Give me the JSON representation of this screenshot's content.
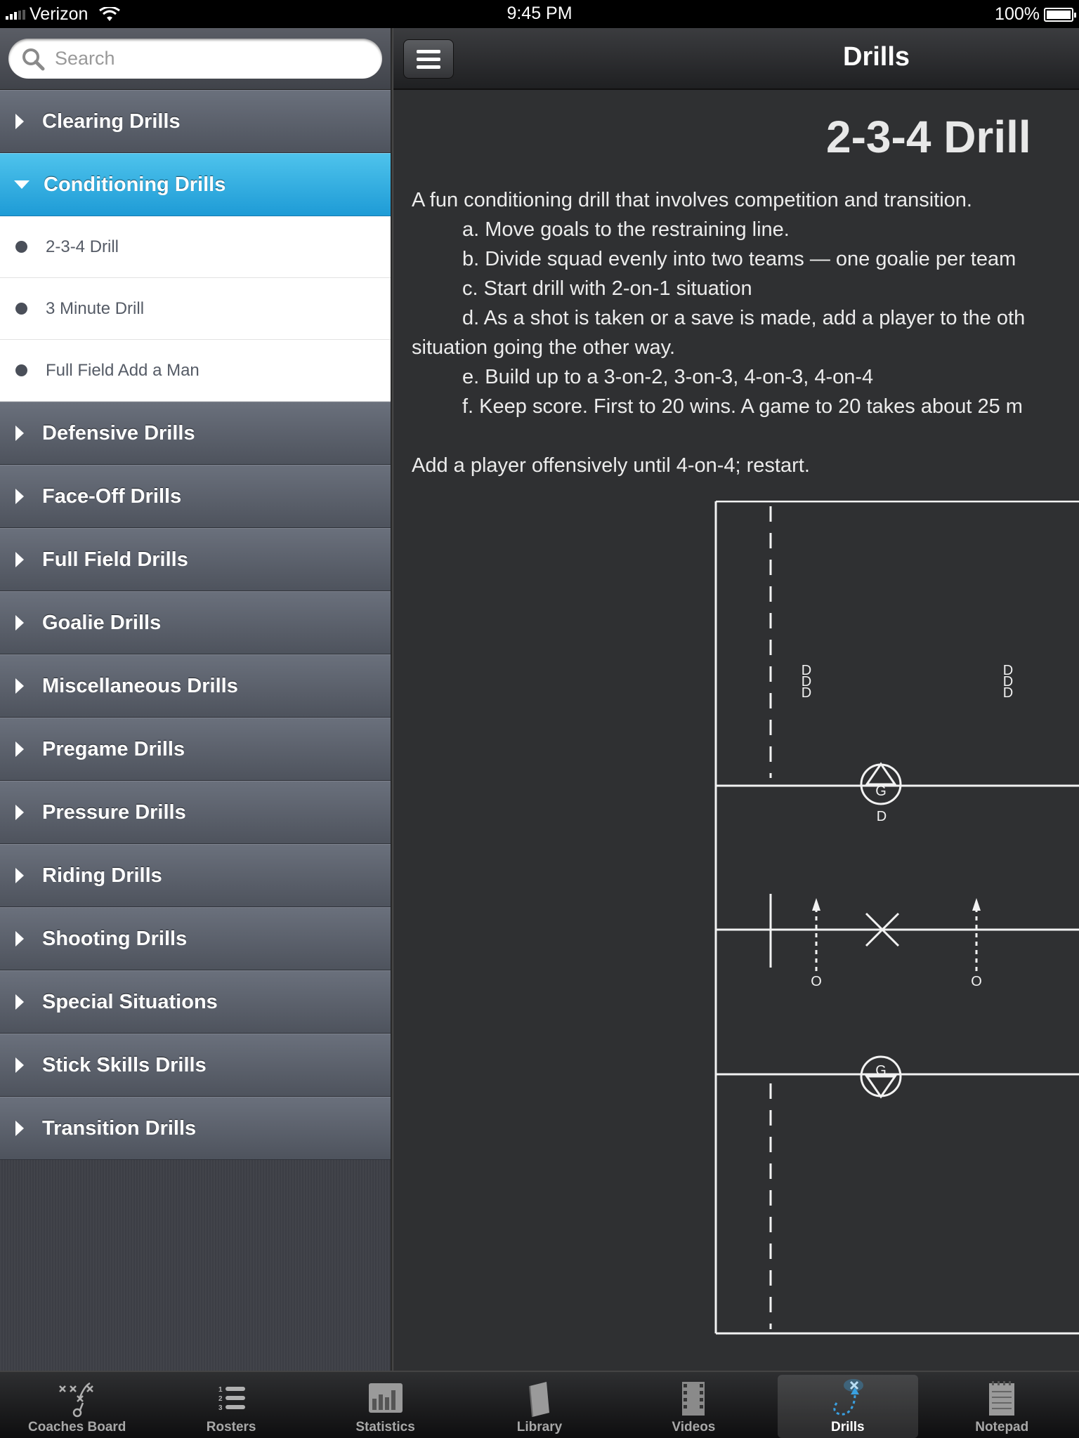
{
  "status_bar": {
    "carrier": "Verizon",
    "time": "9:45 PM",
    "battery": "100%",
    "battery_level": 1.0
  },
  "search": {
    "placeholder": "Search"
  },
  "sidebar": {
    "categories_top": [
      {
        "label": "Clearing Drills"
      },
      {
        "label": "Conditioning Drills",
        "expanded": true
      }
    ],
    "sub_items": [
      {
        "label": "2-3-4 Drill"
      },
      {
        "label": "3 Minute Drill"
      },
      {
        "label": "Full Field Add a Man"
      }
    ],
    "categories_bottom": [
      {
        "label": "Defensive Drills"
      },
      {
        "label": "Face-Off Drills"
      },
      {
        "label": "Full Field Drills"
      },
      {
        "label": "Goalie Drills"
      },
      {
        "label": "Miscellaneous Drills"
      },
      {
        "label": "Pregame Drills"
      },
      {
        "label": "Pressure Drills"
      },
      {
        "label": "Riding Drills"
      },
      {
        "label": "Shooting Drills"
      },
      {
        "label": "Special Situations"
      },
      {
        "label": "Stick Skills Drills"
      },
      {
        "label": "Transition Drills"
      }
    ]
  },
  "header": {
    "title": "Drills"
  },
  "drill": {
    "title": "2-3-4 Drill",
    "intro": "A fun conditioning drill that involves competition and transition.",
    "step_a": "a. Move goals to the restraining line.",
    "step_b": "b. Divide squad evenly into two teams — one goalie per team",
    "step_c": "c. Start drill with 2-on-1 situation",
    "step_d": "d. As a shot is taken or a save is made, add a player to the oth",
    "step_d_cont": "situation going the other way.",
    "step_e": "e. Build up to a 3-on-2, 3-on-3, 4-on-3, 4-on-4",
    "step_f": "f. Keep score. First to 20 wins. A game to 20 takes about 25 m",
    "note": "Add a player offensively until 4-on-4; restart.",
    "diagram": {
      "defender_mark": "D",
      "goalie_mark": "G",
      "offense_mark": "O"
    }
  },
  "tabbar": {
    "tabs": [
      {
        "label": "Coaches Board",
        "icon": "coaches-board-icon"
      },
      {
        "label": "Rosters",
        "icon": "rosters-icon"
      },
      {
        "label": "Statistics",
        "icon": "statistics-icon"
      },
      {
        "label": "Library",
        "icon": "library-icon"
      },
      {
        "label": "Videos",
        "icon": "videos-icon"
      },
      {
        "label": "Drills",
        "icon": "drills-icon",
        "selected": true
      },
      {
        "label": "Notepad",
        "icon": "notepad-icon"
      }
    ]
  },
  "colors": {
    "accent": "#1e9bd6",
    "panel": "#2f3032",
    "category": "#5a5f69"
  }
}
